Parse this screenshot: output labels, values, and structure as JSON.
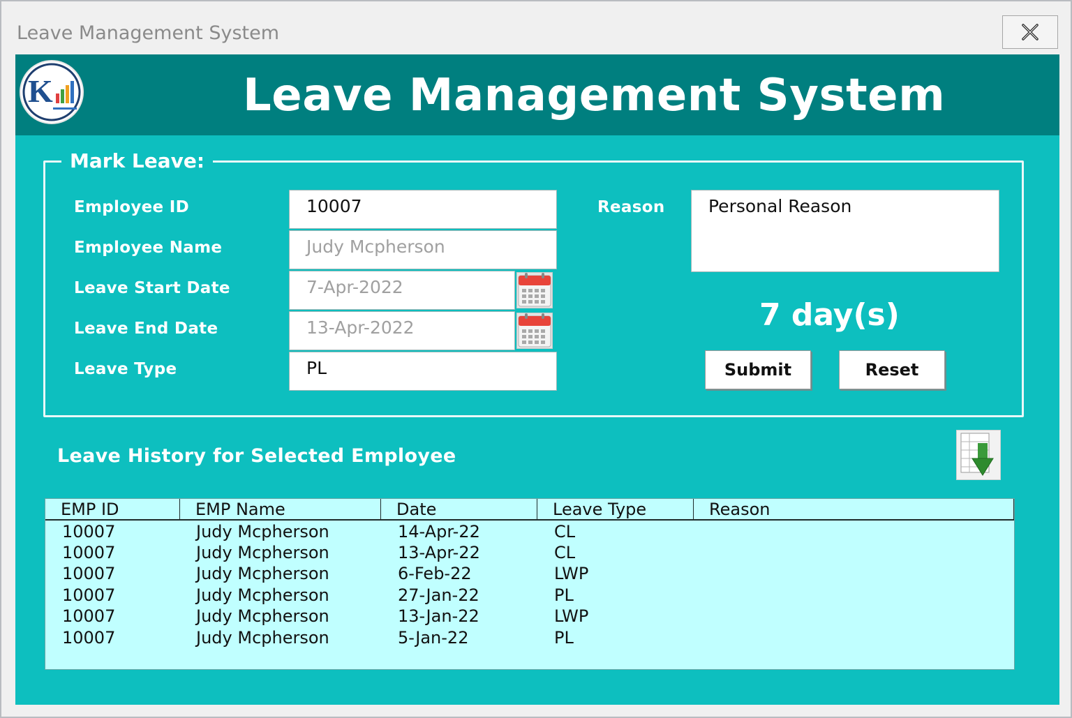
{
  "window": {
    "title": "Leave Management System"
  },
  "banner": {
    "title": "Leave Management System"
  },
  "form": {
    "legend": "Mark Leave:",
    "employee_id": {
      "label": "Employee ID",
      "value": "10007"
    },
    "employee_name": {
      "label": "Employee Name",
      "value": "Judy Mcpherson"
    },
    "leave_start": {
      "label": "Leave Start Date",
      "value": "7-Apr-2022"
    },
    "leave_end": {
      "label": "Leave End Date",
      "value": "13-Apr-2022"
    },
    "leave_type": {
      "label": "Leave Type",
      "value": "PL"
    },
    "reason": {
      "label": "Reason",
      "value": "Personal Reason"
    },
    "days": "7 day(s)",
    "submit_label": "Submit",
    "reset_label": "Reset"
  },
  "history": {
    "title": "Leave History for Selected Employee",
    "columns": [
      "EMP ID",
      "EMP Name",
      "Date",
      "Leave Type",
      "Reason"
    ],
    "rows": [
      [
        "10007",
        "Judy Mcpherson",
        "14-Apr-22",
        "CL",
        ""
      ],
      [
        "10007",
        "Judy Mcpherson",
        "13-Apr-22",
        "CL",
        ""
      ],
      [
        "10007",
        "Judy Mcpherson",
        "6-Feb-22",
        "LWP",
        ""
      ],
      [
        "10007",
        "Judy Mcpherson",
        "27-Jan-22",
        "PL",
        ""
      ],
      [
        "10007",
        "Judy Mcpherson",
        "13-Jan-22",
        "LWP",
        ""
      ],
      [
        "10007",
        "Judy Mcpherson",
        "5-Jan-22",
        "PL",
        ""
      ]
    ]
  },
  "colors": {
    "banner": "#007f7f",
    "form_bg": "#0dbfbf",
    "list_bg": "#c0ffff"
  },
  "icons": {
    "close": "close-icon",
    "logo": "logo-icon",
    "calendar": "calendar-icon",
    "export": "export-excel-icon"
  }
}
